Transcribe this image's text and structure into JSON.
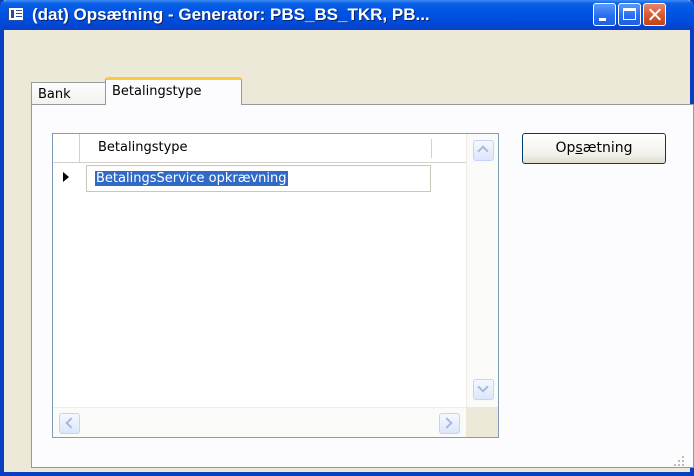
{
  "window": {
    "title": "(dat) Opsætning - Generator: PBS_BS_TKR, PB..."
  },
  "tabs": [
    {
      "label": "Bank",
      "active": false
    },
    {
      "label": "Betalingstype",
      "active": true
    }
  ],
  "grid": {
    "column_header": "Betalingstype",
    "rows": [
      {
        "value": "BetalingsService opkrævning",
        "selected": true
      }
    ]
  },
  "buttons": {
    "setup_prefix": "Op",
    "setup_mnemonic": "s",
    "setup_suffix": "ætning"
  },
  "colors": {
    "titlebar": "#0054e3",
    "active_tab_accent": "#ffc83c",
    "selection": "#316ac5"
  }
}
